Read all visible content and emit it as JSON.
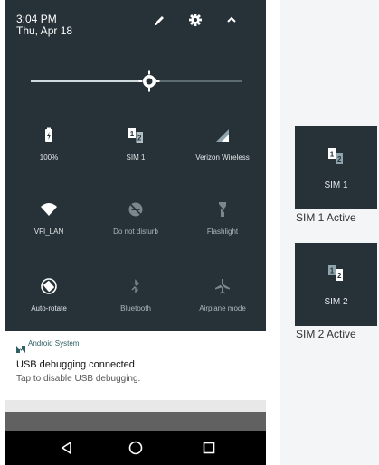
{
  "status_bar": {
    "time": "3:04 PM",
    "date": "Thu, Apr 18"
  },
  "header_icons": [
    "edit-icon",
    "settings-icon",
    "collapse-icon"
  ],
  "brightness": {
    "level": 0.56
  },
  "tiles": [
    {
      "label": "100%",
      "icon": "battery-icon"
    },
    {
      "label": "SIM 1",
      "icon": "sim-switch-icon"
    },
    {
      "label": "Verizon Wireless",
      "icon": "signal-icon"
    },
    {
      "label": "VFI_LAN",
      "icon": "wifi-icon"
    },
    {
      "label": "Do not disturb",
      "icon": "do-not-disturb-icon"
    },
    {
      "label": "Flashlight",
      "icon": "flashlight-icon"
    },
    {
      "label": "Auto-rotate",
      "icon": "auto-rotate-icon"
    },
    {
      "label": "Bluetooth",
      "icon": "bluetooth-icon"
    },
    {
      "label": "Airplane mode",
      "icon": "airplane-icon"
    }
  ],
  "notification": {
    "app": "Android System",
    "title": "USB debugging connected",
    "text": "Tap to disable USB debugging."
  },
  "sim_examples": [
    {
      "label": "SIM 1",
      "caption": "SIM 1 Active"
    },
    {
      "label": "SIM 2",
      "caption": "SIM 2 Active"
    }
  ],
  "colors": {
    "panel": "#263238",
    "accent": "#80cbc4",
    "text": "#ffffff"
  }
}
